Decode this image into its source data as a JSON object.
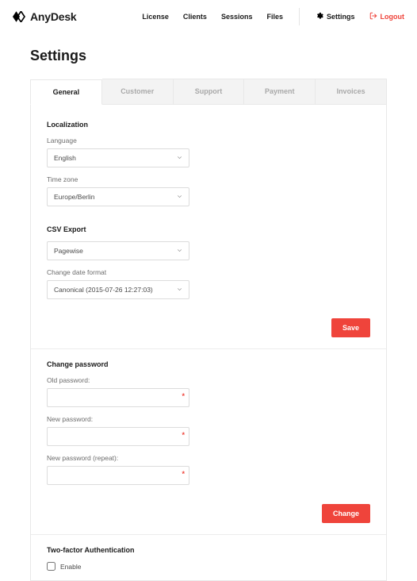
{
  "brand": {
    "name": "AnyDesk"
  },
  "nav": {
    "license": "License",
    "clients": "Clients",
    "sessions": "Sessions",
    "files": "Files",
    "settings": "Settings",
    "logout": "Logout"
  },
  "page": {
    "title": "Settings"
  },
  "tabs": {
    "general": "General",
    "customer": "Customer",
    "support": "Support",
    "payment": "Payment",
    "invoices": "Invoices"
  },
  "localization": {
    "heading": "Localization",
    "language_label": "Language",
    "language_value": "English",
    "timezone_label": "Time zone",
    "timezone_value": "Europe/Berlin"
  },
  "csv_export": {
    "heading": "CSV Export",
    "mode_value": "Pagewise",
    "date_format_label": "Change date format",
    "date_format_value": "Canonical (2015-07-26 12:27:03)"
  },
  "buttons": {
    "save": "Save",
    "change": "Change"
  },
  "change_password": {
    "heading": "Change password",
    "old_label": "Old password:",
    "new_label": "New password:",
    "repeat_label": "New password (repeat):"
  },
  "two_factor": {
    "heading": "Two-factor Authentication",
    "enable_label": "Enable"
  }
}
